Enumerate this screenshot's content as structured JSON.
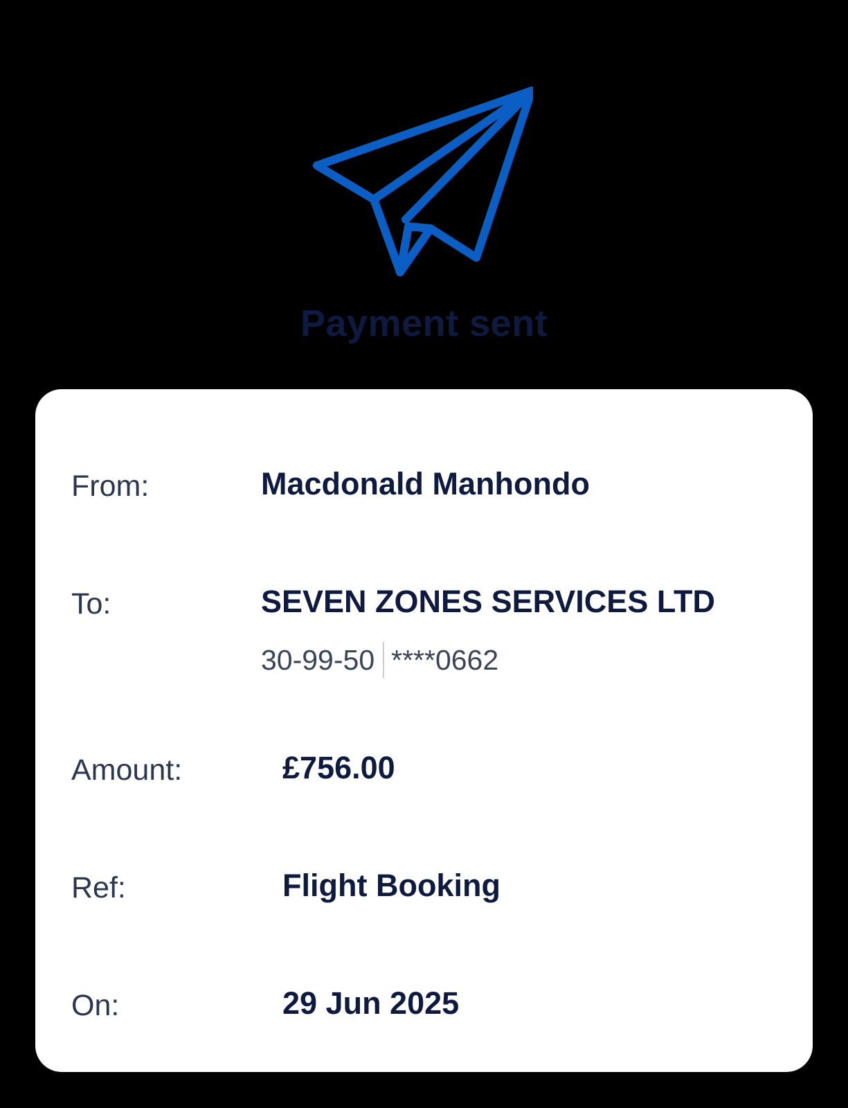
{
  "header": {
    "icon": "paper-plane-icon",
    "title": "Payment sent",
    "accent_color": "#0b5fc4",
    "title_color": "#0e1a40"
  },
  "details": {
    "from": {
      "label": "From:",
      "value": "Macdonald Manhondo"
    },
    "to": {
      "label": "To:",
      "value": "SEVEN ZONES SERVICES LTD",
      "sort_code": "30-99-50",
      "account": "****0662"
    },
    "amount": {
      "label": "Amount:",
      "value": "£756.00"
    },
    "ref": {
      "label": "Ref:",
      "value": "Flight Booking"
    },
    "on": {
      "label": "On:",
      "value": "29 Jun 2025"
    }
  }
}
